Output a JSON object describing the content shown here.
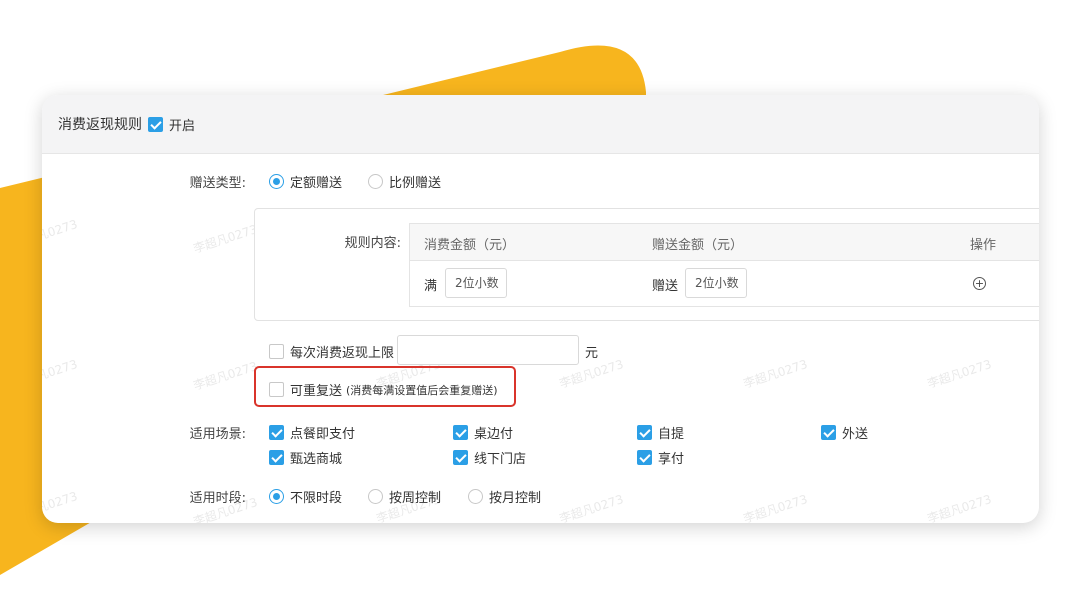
{
  "colors": {
    "accent": "#2b9fe6",
    "yellow": "#f7b51e",
    "highlight": "#d9342b"
  },
  "watermark": "李超凡0273",
  "header": {
    "title": "消费返现规则",
    "enabled_label": "开启",
    "enabled": true
  },
  "gift_type": {
    "label": "赠送类型:",
    "options": [
      {
        "label": "定额赠送",
        "selected": true
      },
      {
        "label": "比例赠送",
        "selected": false
      }
    ]
  },
  "rules": {
    "label": "规则内容:",
    "columns": [
      "消费金额（元）",
      "赠送金额（元）",
      "操作"
    ],
    "row": {
      "prefix": "满",
      "spend_placeholder": "2位小数",
      "gift_prefix": "赠送",
      "gift_placeholder": "2位小数",
      "add_icon": "plus-circle-icon"
    }
  },
  "limit": {
    "label": "每次消费返现上限",
    "unit": "元",
    "checked": false,
    "value": ""
  },
  "repeat": {
    "label": "可重复送",
    "note": "(消费每满设置值后会重复赠送)",
    "checked": false
  },
  "scenes": {
    "label": "适用场景:",
    "items": [
      {
        "label": "点餐即支付",
        "checked": true
      },
      {
        "label": "桌边付",
        "checked": true
      },
      {
        "label": "自提",
        "checked": true
      },
      {
        "label": "外送",
        "checked": true
      },
      {
        "label": "甄选商城",
        "checked": true
      },
      {
        "label": "线下门店",
        "checked": true
      },
      {
        "label": "享付",
        "checked": true
      }
    ]
  },
  "period": {
    "label": "适用时段:",
    "options": [
      {
        "label": "不限时段",
        "selected": true
      },
      {
        "label": "按周控制",
        "selected": false
      },
      {
        "label": "按月控制",
        "selected": false
      }
    ]
  }
}
